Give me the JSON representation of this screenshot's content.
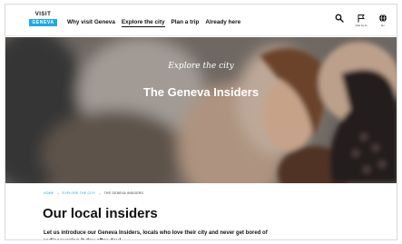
{
  "header": {
    "logo_top": "VISIT",
    "logo_bottom": "GENEVA",
    "nav": [
      {
        "label": "Why visit Geneva"
      },
      {
        "label": "Explore the city"
      },
      {
        "label": "Plan a trip"
      },
      {
        "label": "Already here"
      }
    ],
    "tools": {
      "search_icon": "search-icon",
      "flag_label": "Visit by fo",
      "globe_label": "En"
    }
  },
  "hero": {
    "eyebrow": "Explore the city",
    "title": "The Geneva Insiders"
  },
  "breadcrumb": [
    "HOME",
    "EXPLORE THE CITY",
    "THE GENEVA INSIDERS"
  ],
  "main": {
    "title": "Our local insiders",
    "intro": "Let us introduce our Geneva Insiders, locals who love their city and never get bored of rediscovering it day after day!"
  },
  "colors": {
    "accent": "#21a9e1",
    "breadcrumb_link": "#2a9cd6"
  }
}
